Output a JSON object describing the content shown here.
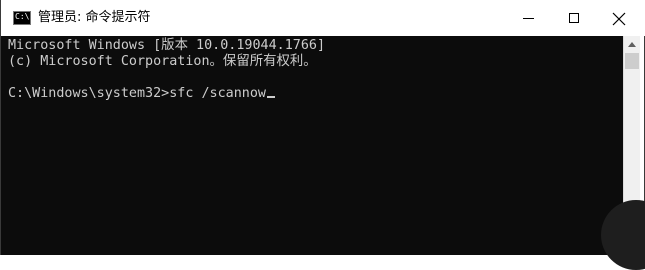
{
  "window": {
    "title": "管理员: 命令提示符",
    "icon_glyph": "C:\\",
    "icons": {
      "app": "cmd-icon",
      "minimize": "minimize-icon",
      "maximize": "maximize-icon",
      "close": "close-icon"
    }
  },
  "console": {
    "lines": [
      "Microsoft Windows [版本 10.0.19044.1766]",
      "(c) Microsoft Corporation。保留所有权利。",
      "C:\\Windows\\system32>sfc /scannow"
    ],
    "colors": {
      "background": "#0c0c0c",
      "foreground": "#cccccc"
    }
  }
}
